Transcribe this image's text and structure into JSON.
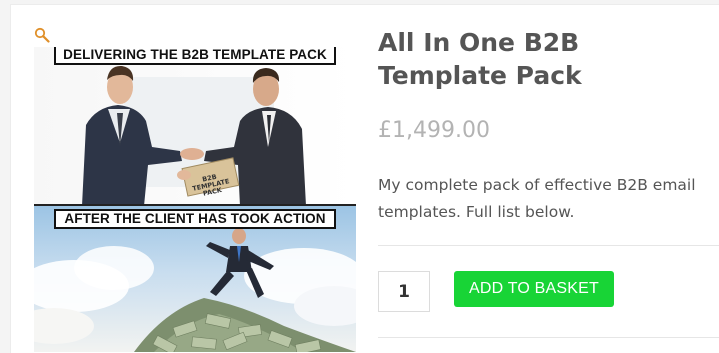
{
  "product": {
    "title": "All In One B2B Template Pack",
    "price": "£1,499.00",
    "description": "My complete pack of effective B2B email templates. Full list below.",
    "quantity": "1",
    "add_to_basket_label": "ADD TO BASKET"
  },
  "image": {
    "caption_top": "DELIVERING THE B2B TEMPLATE PACK",
    "caption_bottom": "AFTER THE CLIENT HAS TOOK ACTION",
    "envelope_line1": "B2B",
    "envelope_line2": "TEMPLATE",
    "envelope_line3": "PACK"
  },
  "icons": {
    "zoom": "magnifier-icon"
  },
  "colors": {
    "accent_button": "#18d436",
    "title_text": "#555555",
    "price_text": "#b3b3b3",
    "zoom_icon": "#e0902a"
  }
}
